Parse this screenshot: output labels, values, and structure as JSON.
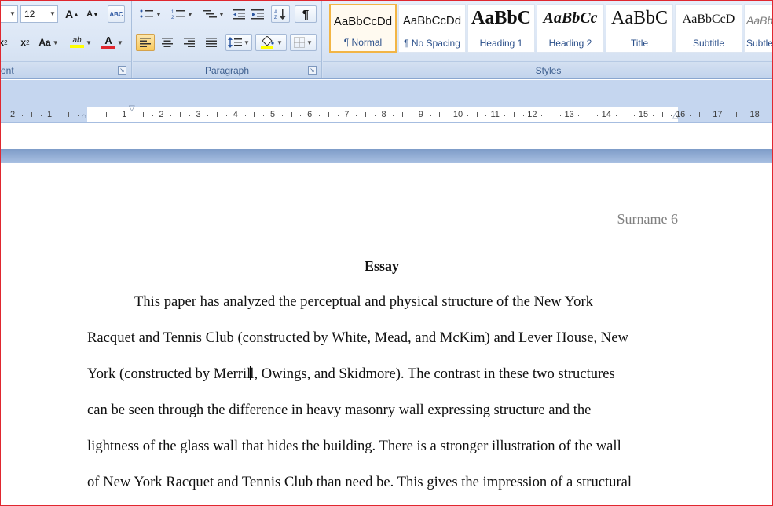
{
  "ribbon": {
    "font": {
      "font_size": "12",
      "group_label": "ont",
      "glyphs": {
        "grow": "A",
        "shrink": "A",
        "subscript": "x",
        "superscript": "x",
        "change_case": "Aa",
        "highlight": "ab",
        "font_color": "A",
        "clear": "ABC"
      }
    },
    "paragraph": {
      "group_label": "Paragraph",
      "show_marks": "¶"
    },
    "styles": {
      "group_label": "Styles",
      "items": [
        {
          "sample": "AaBbCcDd",
          "name": "¶ Normal"
        },
        {
          "sample": "AaBbCcDd",
          "name": "¶ No Spacing"
        },
        {
          "sample": "AaBbC",
          "name": "Heading 1"
        },
        {
          "sample": "AaBbCc",
          "name": "Heading 2"
        },
        {
          "sample": "AaBbC",
          "name": "Title"
        },
        {
          "sample": "AaBbCcD",
          "name": "Subtitle"
        },
        {
          "sample": "AaBbCc",
          "name": "Subtle"
        }
      ]
    }
  },
  "ruler": {
    "left_labels": [
      "2",
      "1"
    ],
    "labels": [
      "1",
      "2",
      "3",
      "4",
      "5",
      "6",
      "7",
      "8",
      "9",
      "10",
      "11",
      "12",
      "13",
      "14",
      "15",
      "16",
      "17",
      "18"
    ]
  },
  "document": {
    "header": "Surname 6",
    "title": "Essay",
    "lines": [
      "This paper has analyzed the perceptual and physical structure of the New York",
      "Racquet and Tennis Club (constructed by White, Mead, and McKim) and Lever House, New",
      "York (constructed by Merrill, Owings, and Skidmore). The contrast in these two structures",
      "can be seen through the difference in heavy masonry wall expressing structure and the",
      "lightness of the glass wall that hides the building. There is a stronger illustration of the wall",
      "of New York Racquet and Tennis Club than need be. This gives the impression of a structural"
    ],
    "line3_before_caret": "York (constructed by Merril",
    "line3_after_caret": "l, Owings, and Skidmore). The contrast in these two structures"
  },
  "colors": {
    "ribbon_bg": "#dbe6f5",
    "selected_style_border": "#f2b545",
    "window_border": "#e0272f",
    "highlight_yellow": "#ffff00",
    "font_red": "#e0272f"
  }
}
